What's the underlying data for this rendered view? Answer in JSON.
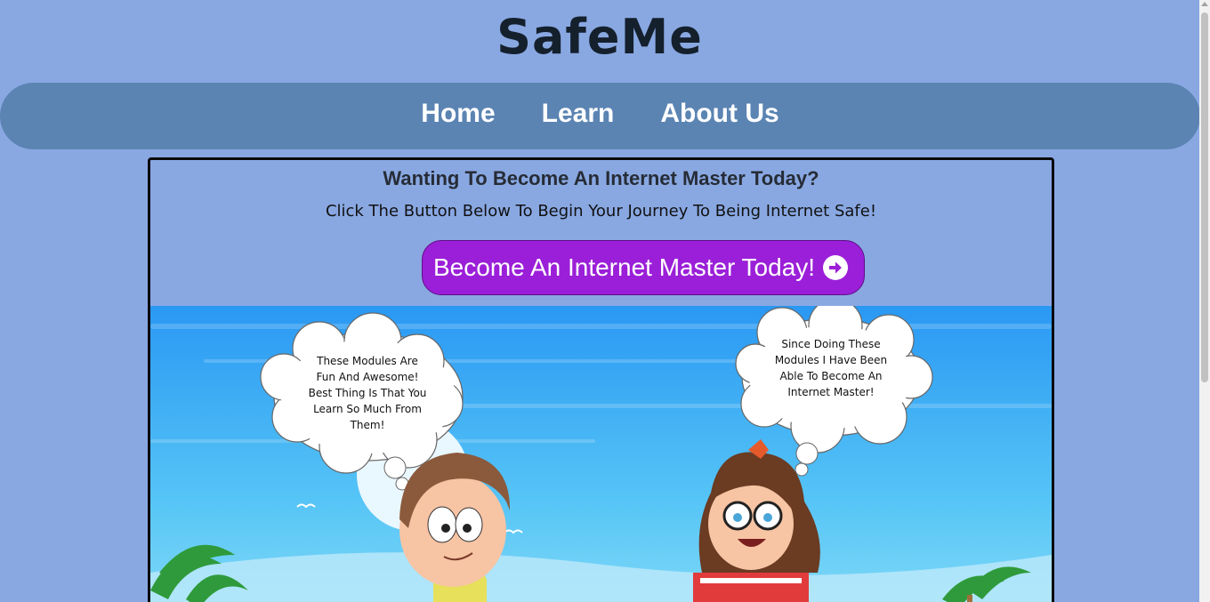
{
  "header": {
    "logo_text": "SafeMe"
  },
  "nav": {
    "items": [
      {
        "label": "Home"
      },
      {
        "label": "Learn"
      },
      {
        "label": "About Us"
      }
    ]
  },
  "hero": {
    "title": "Wanting To Become An Internet Master Today?",
    "subtitle": "Click The Button Below To Begin Your Journey To Being Internet Safe!",
    "cta_label": "Become An Internet Master Today!",
    "cta_icon": "arrow-circle-right-icon"
  },
  "illustration": {
    "boy_bubble": [
      "These Modules Are",
      "Fun And Awesome!",
      "Best Thing Is That You",
      "Learn So Much From",
      "Them!"
    ],
    "girl_bubble": [
      "Since Doing These",
      "Modules I Have Been",
      "Able To Become An",
      "Internet Master!"
    ]
  },
  "colors": {
    "background": "#89a8e2",
    "navbar": "#5b84b3",
    "cta": "#9b1fd8",
    "sky": "#2f9ef5",
    "logo": "#15202d"
  }
}
